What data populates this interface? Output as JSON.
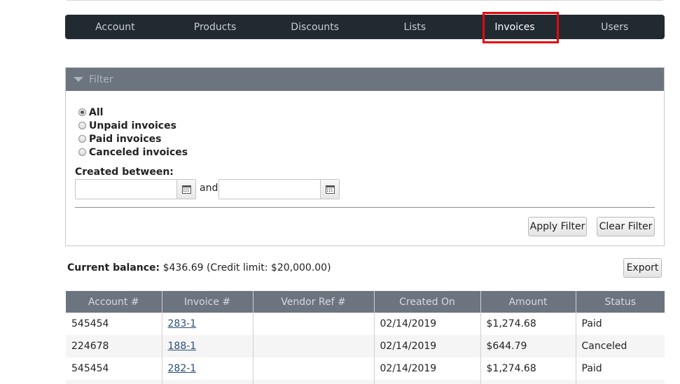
{
  "nav": {
    "items": [
      {
        "label": "Account"
      },
      {
        "label": "Products"
      },
      {
        "label": "Discounts"
      },
      {
        "label": "Lists"
      },
      {
        "label": "Invoices",
        "active": true
      },
      {
        "label": "Users"
      }
    ],
    "highlight_color": "#e5080b"
  },
  "filter": {
    "title": "Filter",
    "options": [
      {
        "label": "All",
        "checked": true
      },
      {
        "label": "Unpaid invoices",
        "checked": false
      },
      {
        "label": "Paid invoices",
        "checked": false
      },
      {
        "label": "Canceled invoices",
        "checked": false
      }
    ],
    "created_between_label": "Created between:",
    "and_label": "and",
    "date_from": "",
    "date_to": "",
    "apply_label": "Apply Filter",
    "clear_label": "Clear Filter"
  },
  "balance": {
    "label": "Current balance:",
    "value": "$436.69 (Credit limit: $20,000.00)"
  },
  "export_label": "Export",
  "table": {
    "headers": [
      "Account #",
      "Invoice #",
      "Vendor Ref #",
      "Created On",
      "Amount",
      "Status"
    ],
    "rows": [
      {
        "account": "545454",
        "invoice": "283-1",
        "vendor_ref": "",
        "created_on": "02/14/2019",
        "amount": "$1,274.68",
        "status": "Paid"
      },
      {
        "account": "224678",
        "invoice": "188-1",
        "vendor_ref": "",
        "created_on": "02/14/2019",
        "amount": "$644.79",
        "status": "Canceled"
      },
      {
        "account": "545454",
        "invoice": "282-1",
        "vendor_ref": "",
        "created_on": "02/14/2019",
        "amount": "$1,274.68",
        "status": "Paid"
      }
    ]
  },
  "colors": {
    "nav_bg": "#212a31",
    "header_bg": "#6c7480",
    "link": "#2a4e7c"
  }
}
